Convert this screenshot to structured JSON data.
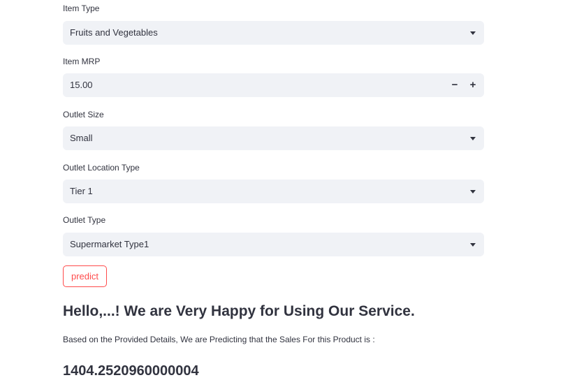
{
  "form": {
    "item_type": {
      "label": "Item Type",
      "value": "Fruits and Vegetables"
    },
    "item_mrp": {
      "label": "Item MRP",
      "value": "15.00",
      "minus": "−",
      "plus": "+"
    },
    "outlet_size": {
      "label": "Outlet Size",
      "value": "Small"
    },
    "outlet_location_type": {
      "label": "Outlet Location Type",
      "value": "Tier 1"
    },
    "outlet_type": {
      "label": "Outlet Type",
      "value": "Supermarket Type1"
    }
  },
  "predict_button": {
    "label": "predict"
  },
  "result": {
    "greeting": "Hello,...! We are Very Happy for Using Our Service.",
    "caption": "Based on the Provided Details, We are Predicting that the Sales For this Product is :",
    "value": "1404.2520960000004"
  },
  "icons": {
    "dropdown": "chevron-down-icon"
  }
}
